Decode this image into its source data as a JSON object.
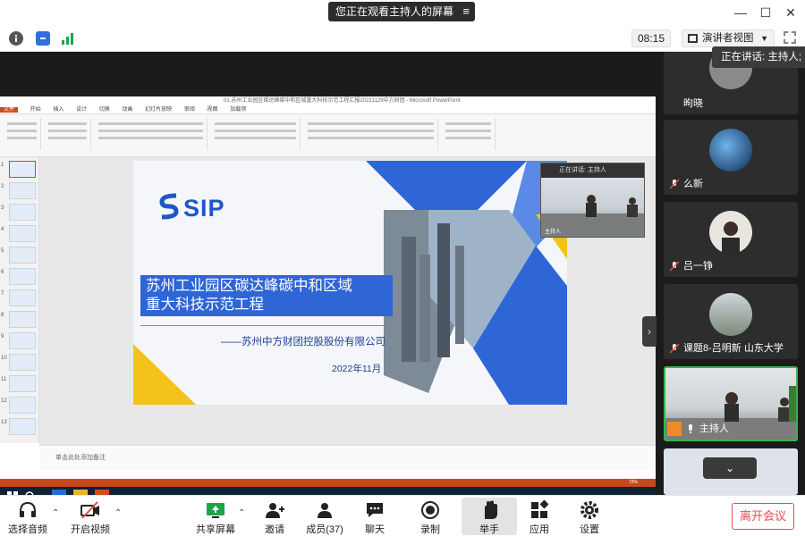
{
  "topbar": {
    "banner_text": "您正在观看主持人的屏幕",
    "menu_icon": "≡"
  },
  "meeting_bar": {
    "timer": "08:15",
    "view_label": "演讲者视图"
  },
  "speaking_tip": "正在讲话: 主持人;",
  "ppt": {
    "window_title": "01.苏州工业园区碳达峰碳中和区域重大科技示范工程汇报20221129中方财团 - Microsoft PowerPoint",
    "tabs": [
      "文件",
      "开始",
      "插入",
      "设计",
      "切换",
      "动画",
      "幻灯片放映",
      "审阅",
      "视图",
      "加载项"
    ],
    "notes_placeholder": "单击此处添加备注",
    "slide": {
      "logo": "SIP",
      "title_line1": "苏州工业园区碳达峰碳中和区域",
      "title_line2": "重大科技示范工程",
      "company": "——苏州中方财团控股股份有限公司",
      "date": "2022年11月"
    },
    "thumb_numbers": [
      "1",
      "2",
      "3",
      "4",
      "5",
      "6",
      "7",
      "8",
      "9",
      "10",
      "11",
      "12",
      "13"
    ],
    "zoom": "72%"
  },
  "pip": {
    "header": "正在讲话: 主持人",
    "name": "主持人"
  },
  "participants": [
    {
      "name": "昫晓",
      "avatar_color": "#8a8a8a"
    },
    {
      "name": "么新",
      "avatar_color": "#1a4c8c"
    },
    {
      "name": "吕一铮",
      "avatar_color": "#c8c0b0"
    },
    {
      "name": "课题8-吕明新 山东大学",
      "avatar_color": "#9ca6ad"
    },
    {
      "name": "主持人",
      "avatar_color": "#7a7f80"
    },
    {
      "name": "",
      "avatar_color": "#dde3e8"
    }
  ],
  "toolbar": {
    "audio": "选择音频",
    "video": "开启视频",
    "share": "共享屏幕",
    "invite": "邀请",
    "members": "成员(37)",
    "chat": "聊天",
    "record": "录制",
    "raise_hand": "举手",
    "apps": "应用",
    "settings": "设置",
    "leave": "离开会议"
  },
  "colors": {
    "accent_blue": "#2f66d6",
    "leave_red": "#e84b4b",
    "ppt_orange": "#d04a1a",
    "shield_blue": "#2f6fe0",
    "signal_green": "#1fa34a"
  }
}
